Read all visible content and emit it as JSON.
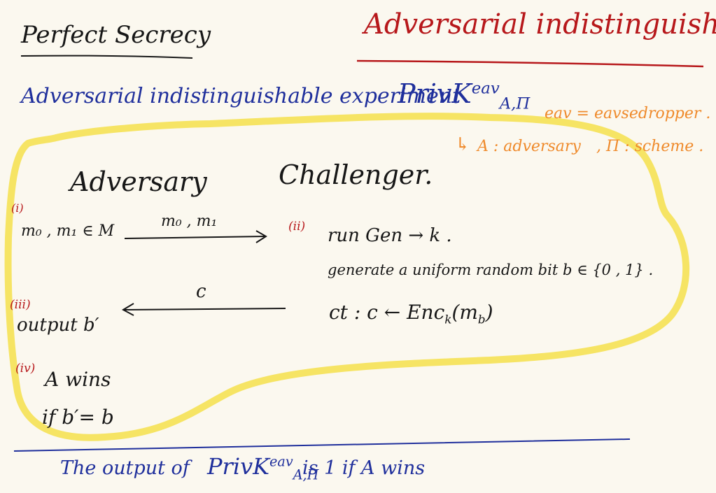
{
  "header": {
    "left_title": "Perfect Secrecy",
    "right_title": "Adversarial indistinguishability"
  },
  "section": {
    "title": "Adversarial indistinguishable experiment",
    "priv_symbol": "PrivK",
    "priv_sup": "eav",
    "priv_sub": "A,Π"
  },
  "notes": {
    "eav": "eav = eavsedropper .",
    "arrow": "↳",
    "a_def": "A : adversary",
    "pi_def": ", Π : scheme ."
  },
  "experiment": {
    "adversary_label": "Adversary",
    "challenger_label": "Challenger.",
    "step_i": "(i)",
    "step_ii": "(ii)",
    "step_iii": "(iii)",
    "step_iv": "(iv)",
    "adv_messages": "m₀ , m₁ ∈ M",
    "arrow_label_top": "m₀ , m₁",
    "run_gen": "run  Gen → k .",
    "generate": "generate  a  uniform  random  bit   b ∈ {0 , 1} .",
    "ct": "ct :     c ← Enc",
    "ct_sub": "k",
    "ct_tail": "(m",
    "ct_sub2": "b",
    "ct_end": ")",
    "arrow_label_bottom": "c",
    "output": "output  b′",
    "wins": "A  wins",
    "if": "if   b′= b"
  },
  "footer": {
    "prefix": "The  output  of",
    "priv_symbol": "PrivK",
    "priv_sup": "eav",
    "priv_sub": "A,Π",
    "suffix": "is  1   if   A  wins"
  }
}
